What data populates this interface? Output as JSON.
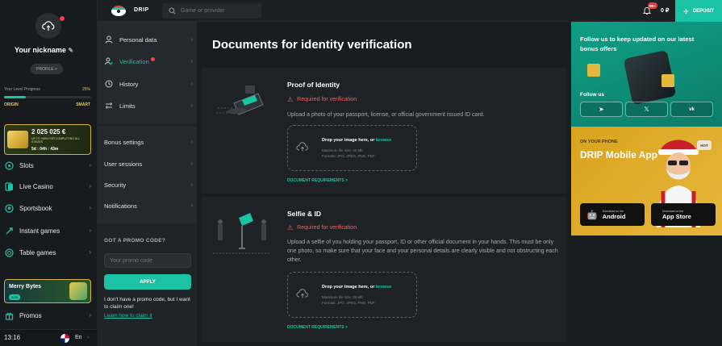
{
  "sidebar": {
    "nickname": "Your nickname",
    "profile_label": "PROFILE >",
    "level_label": "Your Level Progress",
    "level_pct": "25%",
    "level_fraction": 0.25,
    "level_start": "ORIGIN",
    "level_end": "SMART",
    "promo_amount": "2 025 025 €",
    "promo_sub": "UP TO +55% FOR COMPLETING ALL STAGES",
    "promo_timer": "5d : 04h : 43m",
    "items": [
      {
        "label": "Slots",
        "icon": "slots-icon"
      },
      {
        "label": "Live Casino",
        "icon": "live-casino-icon"
      },
      {
        "label": "Sportsbook",
        "icon": "sportsbook-icon"
      },
      {
        "label": "Instant games",
        "icon": "instant-games-icon"
      },
      {
        "label": "Table games",
        "icon": "table-games-icon"
      }
    ],
    "merry_title": "Merry Bytes",
    "merry_badge": "4/28",
    "promos": "Promos",
    "time": "13:16",
    "lang": "En"
  },
  "topbar": {
    "brand": "DRIP",
    "search_placeholder": "Game or provider",
    "notif_count": "99+",
    "balance": "0 ₽",
    "deposit": "DEPOSIT"
  },
  "settings": {
    "account_items": [
      {
        "label": "Personal data",
        "icon": "user-icon"
      },
      {
        "label": "Verification",
        "icon": "verification-icon",
        "active": true
      },
      {
        "label": "History",
        "icon": "clock-icon"
      },
      {
        "label": "Limits",
        "icon": "limits-icon"
      }
    ],
    "other_items": [
      {
        "label": "Bonus settings"
      },
      {
        "label": "User sessions"
      },
      {
        "label": "Security"
      },
      {
        "label": "Notifications"
      }
    ],
    "promo_title": "GOT A PROMO CODE?",
    "promo_placeholder": "Your promo code",
    "apply": "APPLY",
    "no_promo": "I don't have a promo code, but I want to claim one!",
    "how_to": "Learn how to claim it"
  },
  "main": {
    "title": "Documents for identity verification",
    "docs": [
      {
        "title": "Proof of Identity",
        "status": "Required for verification",
        "desc": "Upload a photo of your passport, license, or official government issued ID card.",
        "drop_text": "Drop your image here, or ",
        "browse": "browse",
        "max_size": "Maximum file size: 30 Mb",
        "formats": "Formats: JPG, JPEG, PNG, PDF",
        "link": "DOCUMENT REQUIREMENTS >"
      },
      {
        "title": "Selfie & ID",
        "status": "Required for verification",
        "desc": "Upload a selfie of you holding your passport, ID or other official document in your hands. This must be only one photo, so make sure that your face and your personal details are clearly visible and not obstructing each other.",
        "drop_text": "Drop your image here, or ",
        "browse": "browse",
        "max_size": "Maximum file size: 30 Mb",
        "formats": "Formats: JPG, JPEG, PNG, PDF",
        "link": "DOCUMENT REQUIREMENTS >"
      }
    ]
  },
  "right": {
    "follow_text": "Follow us to keep updated on our latest bonus offers",
    "follow_us": "Follow us",
    "on_phone": "ON YOUR PHONE",
    "mobile_title": "DRIP Mobile App",
    "hot": "HOT",
    "android_small": "Download on the",
    "android": "Android",
    "ios_small": "Download on the",
    "ios": "App Store"
  },
  "colors": {
    "accent": "#19c3a3",
    "danger": "#ff5b5b",
    "gold": "#d4b13a"
  }
}
